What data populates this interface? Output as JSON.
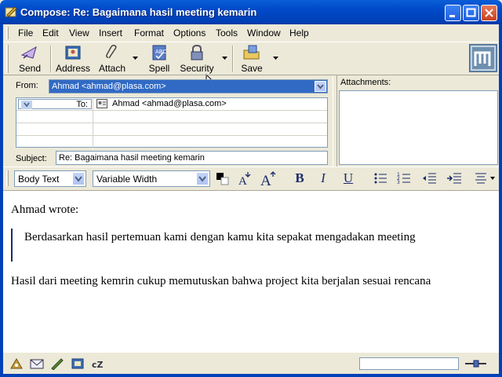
{
  "window": {
    "title": "Compose: Re: Bagaimana hasil meeting kemarin"
  },
  "menu": {
    "items": [
      "File",
      "Edit",
      "View",
      "Insert",
      "Format",
      "Options",
      "Tools",
      "Window",
      "Help"
    ]
  },
  "toolbar": {
    "send": "Send",
    "address": "Address",
    "attach": "Attach",
    "spell": "Spell",
    "security": "Security",
    "save": "Save"
  },
  "header": {
    "from_label": "From:",
    "from_value": "Ahmad <ahmad@plasa.com>",
    "recipients": [
      {
        "type": "To:",
        "value": "Ahmad <ahmad@plasa.com>"
      }
    ],
    "subject_label": "Subject:",
    "subject_value": "Re: Bagaimana hasil meeting kemarin",
    "attachments_label": "Attachments:"
  },
  "format": {
    "paragraph_style": "Body Text",
    "font": "Variable Width",
    "bold": "B",
    "italic": "I",
    "underline": "U"
  },
  "message": {
    "attribution": "Ahmad wrote:",
    "quoted": "Berdasarkan hasil pertemuan kami dengan kamu kita sepakat mengadakan meeting",
    "reply": "Hasil dari meeting kemrin cukup memutuskan bahwa project kita berjalan sesuai rencana"
  },
  "colors": {
    "titlebar": "#0041b8",
    "selection": "#316ac5",
    "chrome": "#ece9d8"
  }
}
